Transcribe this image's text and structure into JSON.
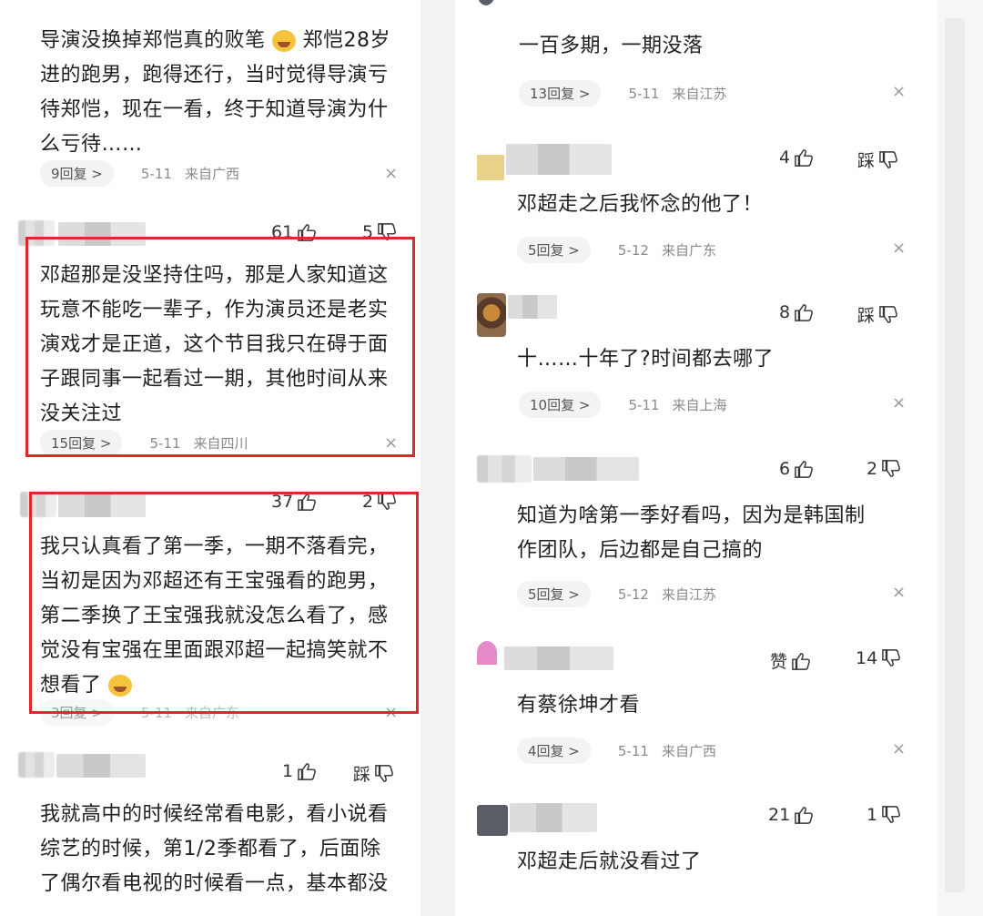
{
  "left": {
    "comments": [
      {
        "lines": [
          "导演没换掉郑恺真的败笔",
          "郑恺28岁",
          "进的跑男，跑得还行，当时觉得导演亏",
          "待郑恺，现在一看，终于知道导演为什",
          "么亏待……"
        ],
        "replies": "9回复 >",
        "date": "5-11",
        "location": "来自广西"
      },
      {
        "likes": "61",
        "dislikes": "5",
        "lines": [
          "邓超那是没坚持住吗，那是人家知道这",
          "玩意不能吃一辈子，作为演员还是老实",
          "演戏才是正道，这个节目我只在碍于面",
          "子跟同事一起看过一期，其他时间从来",
          "没关注过"
        ],
        "replies": "15回复 >",
        "date": "5-11",
        "location": "来自四川"
      },
      {
        "likes": "37",
        "dislikes": "2",
        "lines": [
          "我只认真看了第一季，一期不落看完，",
          "当初是因为邓超还有王宝强看的跑男，",
          "第二季换了王宝强我就没怎么看了，感",
          "觉没有宝强在里面跟邓超一起搞笑就不",
          "想看了"
        ],
        "replies": "3回复 >",
        "date": "5-11",
        "location": "来自广东"
      },
      {
        "likes": "1",
        "dislikes": "踩",
        "lines": [
          "我就高中的时候经常看电影，看小说看",
          "综艺的时候，第1/2季都看了，后面除",
          "了偶尔看电视的时候看一点，基本都没"
        ]
      }
    ]
  },
  "right": {
    "comments": [
      {
        "lines": [
          "一百多期，一期没落"
        ],
        "replies": "13回复 >",
        "date": "5-11",
        "location": "来自江苏"
      },
      {
        "likes": "4",
        "dislikes": "踩",
        "lines": [
          "邓超走之后我怀念的他了！"
        ],
        "replies": "5回复 >",
        "date": "5-12",
        "location": "来自广东"
      },
      {
        "likes": "8",
        "dislikes": "踩",
        "lines": [
          "十……十年了?时间都去哪了"
        ],
        "replies": "10回复 >",
        "date": "5-11",
        "location": "来自上海"
      },
      {
        "likes": "6",
        "dislikes": "2",
        "lines": [
          "知道为啥第一季好看吗，因为是韩国制",
          "作团队，后边都是自己搞的"
        ],
        "replies": "5回复 >",
        "date": "5-12",
        "location": "来自江苏"
      },
      {
        "likes": "赞",
        "dislikes": "14",
        "lines": [
          "有蔡徐坤才看"
        ],
        "replies": "4回复 >",
        "date": "5-11",
        "location": "来自广西"
      },
      {
        "likes": "21",
        "dislikes": "1",
        "lines": [
          "邓超走后就没看过了"
        ]
      }
    ]
  },
  "colors": {
    "highlight": "#e0282a",
    "meta": "#8a8a8a",
    "text": "#1f1f1f"
  },
  "icons": {
    "like": "thumb-up-icon",
    "dislike": "thumb-down-icon",
    "close": "close-icon"
  }
}
